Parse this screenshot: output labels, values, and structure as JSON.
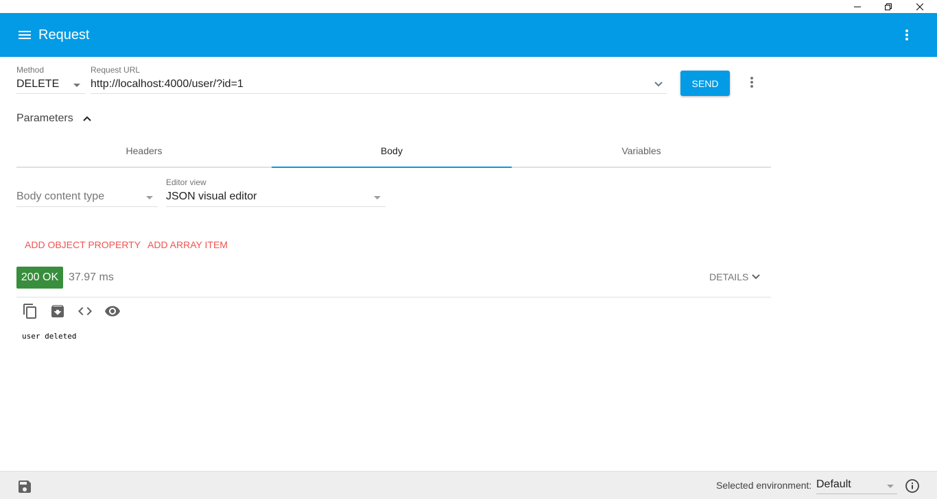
{
  "window": {
    "controls": {
      "minimize_icon": "minimize-icon",
      "restore_icon": "restore-icon",
      "close_icon": "close-icon"
    }
  },
  "appbar": {
    "title": "Request",
    "menu_icon": "hamburger-menu-icon",
    "more_icon": "more-vertical-icon",
    "color": "#039be5"
  },
  "request": {
    "method_label": "Method",
    "method_value": "DELETE",
    "url_label": "Request URL",
    "url_value": "http://localhost:4000/user/?id=1",
    "send_label": "SEND"
  },
  "parameters": {
    "label": "Parameters",
    "expanded": true,
    "tabs": [
      {
        "label": "Headers",
        "active": false
      },
      {
        "label": "Body",
        "active": true
      },
      {
        "label": "Variables",
        "active": false
      }
    ]
  },
  "body_editor": {
    "content_type_placeholder": "Body content type",
    "editor_view_label": "Editor view",
    "editor_view_value": "JSON visual editor",
    "add_object_property": "ADD OBJECT PROPERTY",
    "add_array_item": "ADD ARRAY ITEM",
    "action_color": "#ef5350"
  },
  "response": {
    "status": "200 OK",
    "status_color": "#388e3c",
    "timing": "37.97 ms",
    "details_label": "DETAILS",
    "body": "user deleted",
    "toolbar": [
      "copy-icon",
      "save-download-icon",
      "code-icon",
      "preview-eye-icon"
    ]
  },
  "footer": {
    "env_label": "Selected environment:",
    "env_value": "Default"
  }
}
